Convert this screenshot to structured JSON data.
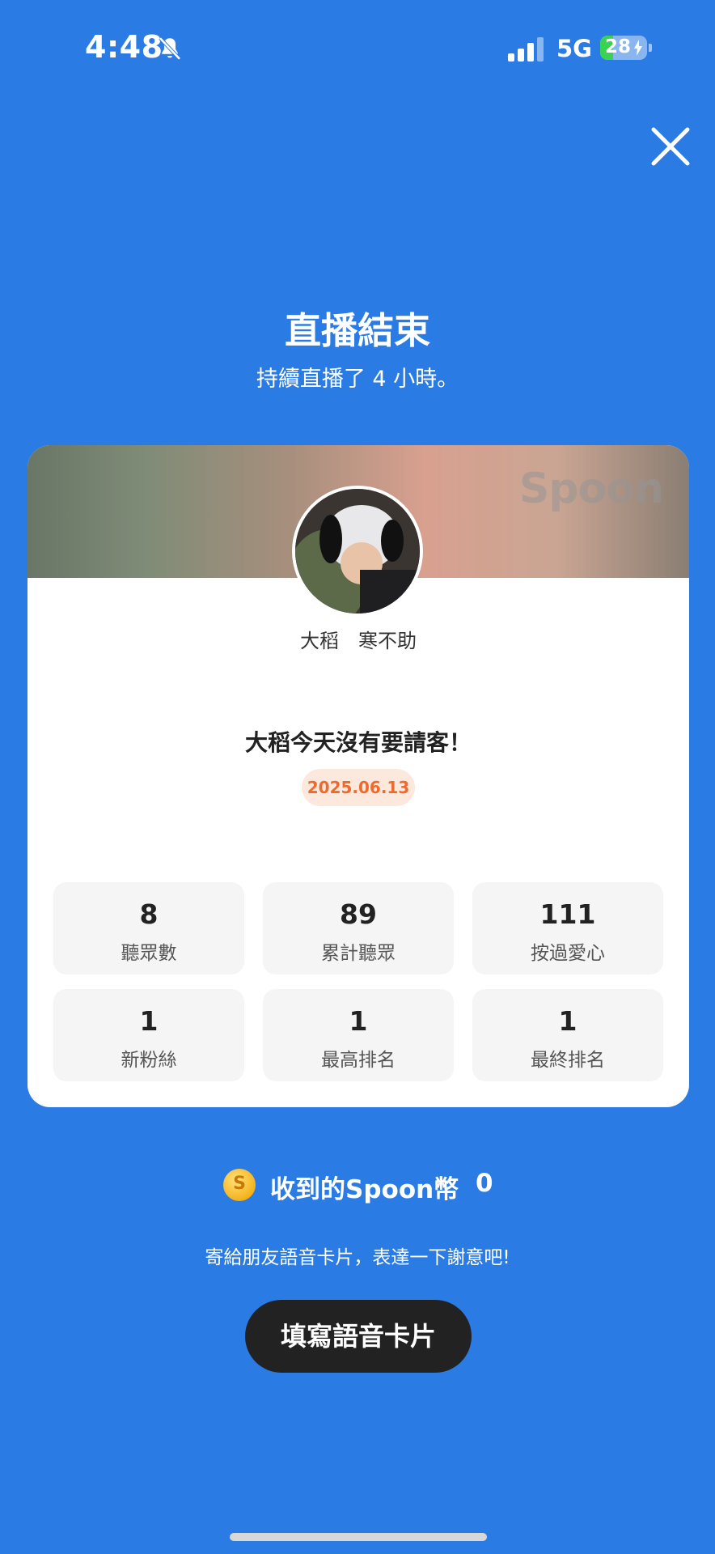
{
  "status_bar": {
    "time": "4:48",
    "network": "5G",
    "battery_level": "28",
    "battery_fraction": 0.28,
    "battery_color": "#39D353"
  },
  "header": {
    "title": "直播結束",
    "subtitle": "持續直播了 4 小時。"
  },
  "card": {
    "watermark": "Spoon",
    "dj_name": "大稻　寒不助",
    "room_title": "大稻今天沒有要請客！",
    "date": "2025.06.13",
    "stats": [
      {
        "value": "8",
        "label": "聽眾數"
      },
      {
        "value": "89",
        "label": "累計聽眾"
      },
      {
        "value": "111",
        "label": "按過愛心"
      },
      {
        "value": "1",
        "label": "新粉絲"
      },
      {
        "value": "1",
        "label": "最高排名"
      },
      {
        "value": "1",
        "label": "最終排名"
      }
    ]
  },
  "coins": {
    "icon": "coin-icon",
    "label": "收到的Spoon幣",
    "value": "0",
    "coin_symbol": "S"
  },
  "hint": "寄給朋友語音卡片，表達一下謝意吧!",
  "action": {
    "label": "填寫語音卡片"
  },
  "colors": {
    "background": "#2A7BE3",
    "date_accent": "#EE6B2D",
    "button": "#222222"
  }
}
